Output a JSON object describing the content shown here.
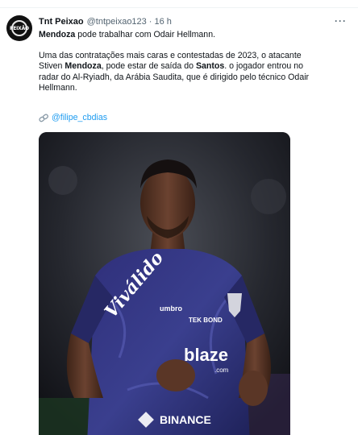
{
  "tweet": {
    "display_name": "Tnt Peixao",
    "handle": "@tntpeixao123",
    "separator": "·",
    "time": "16 h",
    "more_label": "···",
    "avatar_text": "PEIXÃO",
    "headline_bold": "Mendoza",
    "headline_rest": " pode trabalhar com Odair Hellmann.",
    "para_line1": "Uma das contratações mais caras e contestadas de 2023, o atacante",
    "para_line2_a": "Stiven ",
    "para_line2_bold1": "Mendoza",
    "para_line2_b": ", pode estar de saída do ",
    "para_line2_bold2": "Santos",
    "para_line2_c": ".  o jogador entrou no",
    "para_line3": "radar do Al-Ryiadh, da Arábia Saudita, que é dirigido pelo técnico Odair",
    "para_line4": "Hellmann.",
    "mention": "@filipe_cbdias",
    "mention_icon": "link-icon"
  },
  "photo": {
    "jersey_sponsor_top": "Viválido",
    "jersey_brand": "umbro",
    "jersey_sponsor_chest": "blaze",
    "jersey_sponsor_chest_suffix": ".com",
    "jersey_sponsor_bottom": "BINANCE",
    "jersey_sponsor_side": "TEK BOND",
    "colors": {
      "jersey": "#2a2d6e",
      "background": "#1a1c22",
      "skin": "#5a3626"
    }
  }
}
